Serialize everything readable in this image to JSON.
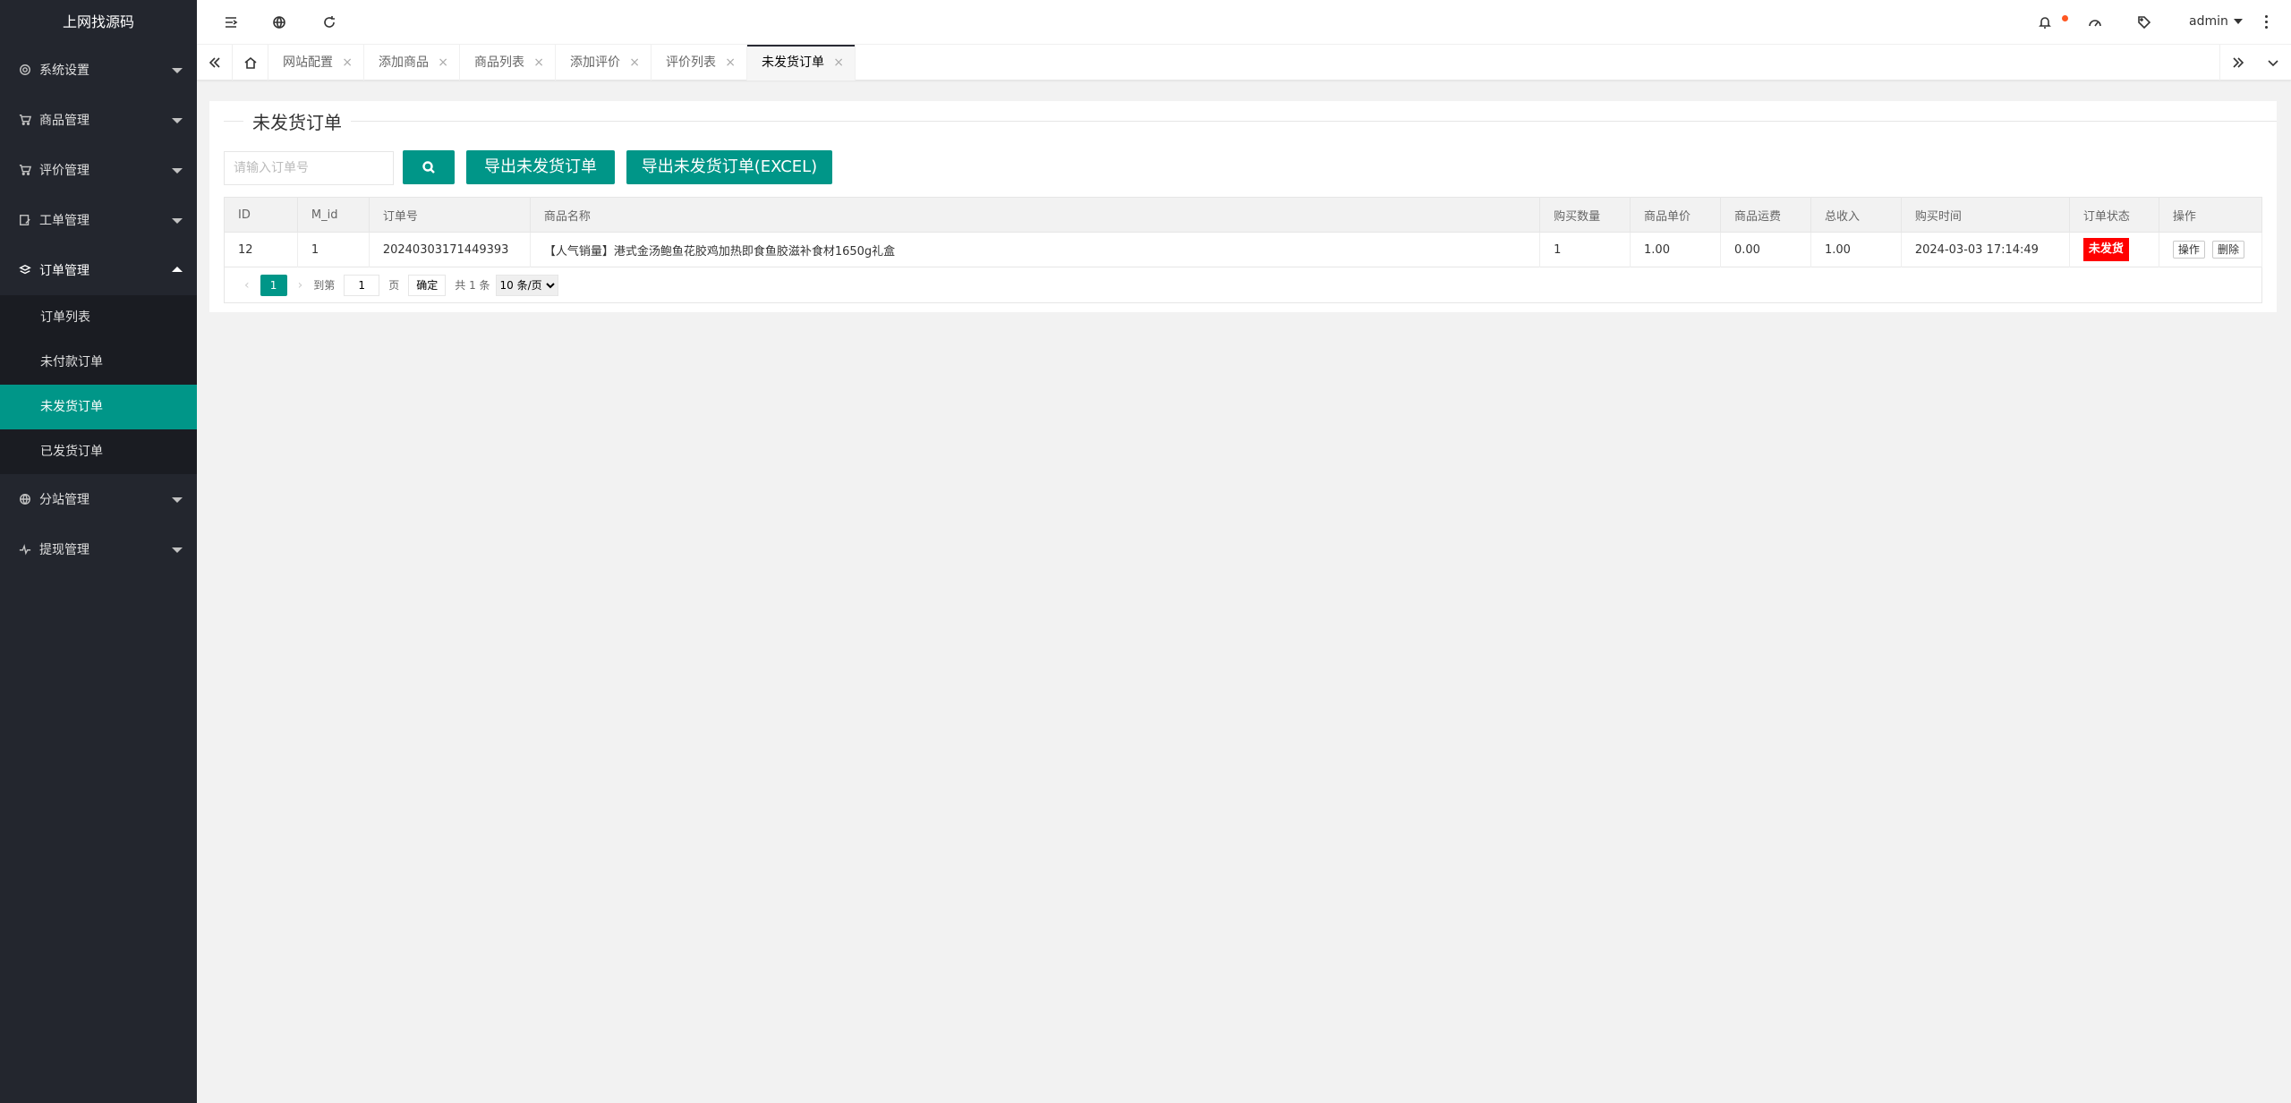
{
  "app": {
    "logo": "上网找源码"
  },
  "sidebar": {
    "items": [
      {
        "label": "系统设置",
        "icon": "gear-icon"
      },
      {
        "label": "商品管理",
        "icon": "cart-icon"
      },
      {
        "label": "评价管理",
        "icon": "cart-icon"
      },
      {
        "label": "工单管理",
        "icon": "edit-icon"
      },
      {
        "label": "订单管理",
        "icon": "layers-icon"
      },
      {
        "label": "分站管理",
        "icon": "globe-icon"
      },
      {
        "label": "提现管理",
        "icon": "pulse-icon"
      }
    ],
    "orders_sub": [
      {
        "label": "订单列表"
      },
      {
        "label": "未付款订单"
      },
      {
        "label": "未发货订单"
      },
      {
        "label": "已发货订单"
      }
    ]
  },
  "header": {
    "user": "admin"
  },
  "tabs": [
    {
      "label": "网站配置"
    },
    {
      "label": "添加商品"
    },
    {
      "label": "商品列表"
    },
    {
      "label": "添加评价"
    },
    {
      "label": "评价列表"
    },
    {
      "label": "未发货订单"
    }
  ],
  "tab_close": "×",
  "main": {
    "title": "未发货订单",
    "search_placeholder": "请输入订单号",
    "export_label": "导出未发货订单",
    "export_excel_label": "导出未发货订单(EXCEL)"
  },
  "table": {
    "columns": [
      "ID",
      "M_id",
      "订单号",
      "商品名称",
      "购买数量",
      "商品单价",
      "商品运费",
      "总收入",
      "购买时间",
      "订单状态",
      "操作"
    ],
    "rows": [
      {
        "id": "12",
        "m_id": "1",
        "order_no": "20240303171449393",
        "product": "【人气销量】港式金汤鲍鱼花胶鸡加热即食鱼胶滋补食材1650g礼盒",
        "qty": "1",
        "price": "1.00",
        "freight": "0.00",
        "total": "1.00",
        "time": "2024-03-03 17:14:49",
        "status": "未发货",
        "action_op": "操作",
        "action_del": "删除"
      }
    ]
  },
  "pager": {
    "current": "1",
    "goto_label": "到第",
    "goto_value": "1",
    "page_unit": "页",
    "confirm": "确定",
    "total": "共 1 条",
    "per_page": "10 条/页"
  },
  "colors": {
    "accent": "#009688",
    "sidebar": "#23262e",
    "danger": "#ff0000"
  }
}
